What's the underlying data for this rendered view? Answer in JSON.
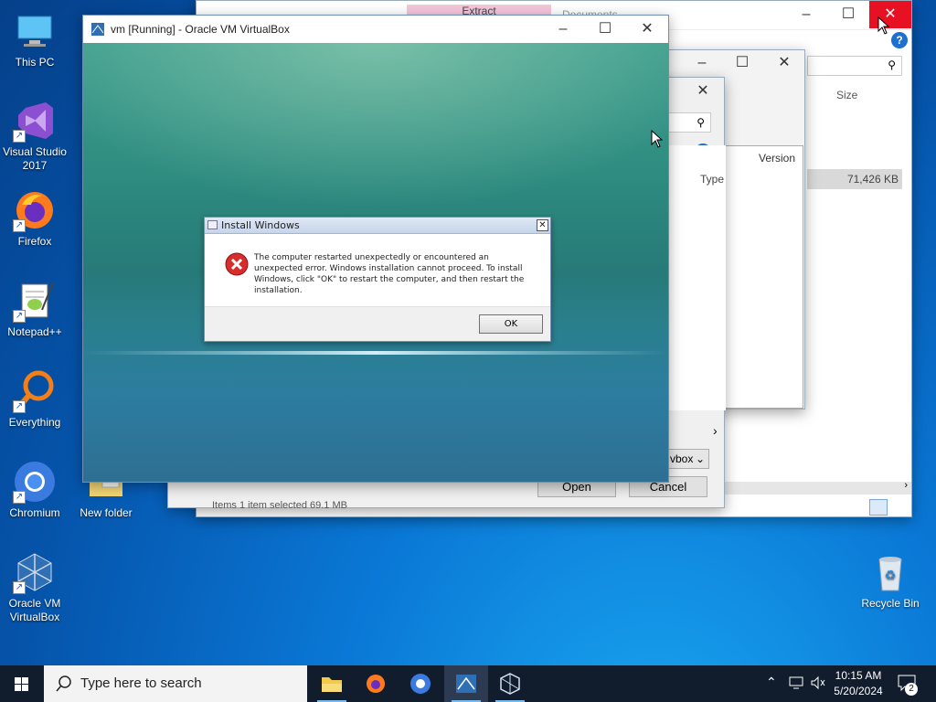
{
  "desktop": {
    "icons": [
      {
        "label": "This PC"
      },
      {
        "label": "Visual Studio 2017"
      },
      {
        "label": "Firefox"
      },
      {
        "label": "Notepad++"
      },
      {
        "label": "Everything"
      },
      {
        "label": "Chromium"
      },
      {
        "label": "New folder"
      },
      {
        "label": "Oracle VM VirtualBox"
      },
      {
        "label": "Recycle Bin"
      }
    ]
  },
  "explorer": {
    "tab_label": "Extract",
    "title": "Documents",
    "columns": {
      "size": "Size",
      "version": "Version",
      "type": "Type"
    },
    "row_size": "71,426 KB",
    "filter": "vbox",
    "status": "Items   1 item selected   69.1 MB"
  },
  "file_dialog": {
    "open_label": "Open",
    "cancel_label": "Cancel"
  },
  "vbox": {
    "title": "vm [Running] - Oracle VM VirtualBox"
  },
  "install_dialog": {
    "title": "Install Windows",
    "message": "The computer restarted unexpectedly or encountered an unexpected error. Windows installation cannot proceed. To install Windows, click \"OK\" to restart the computer, and then restart the installation.",
    "ok_label": "OK"
  },
  "taskbar": {
    "search_placeholder": "Type here to search",
    "time": "10:15 AM",
    "date": "5/20/2024",
    "notification_count": "2"
  },
  "colors": {
    "close_red": "#e81123",
    "taskbar": "#111c2d"
  }
}
